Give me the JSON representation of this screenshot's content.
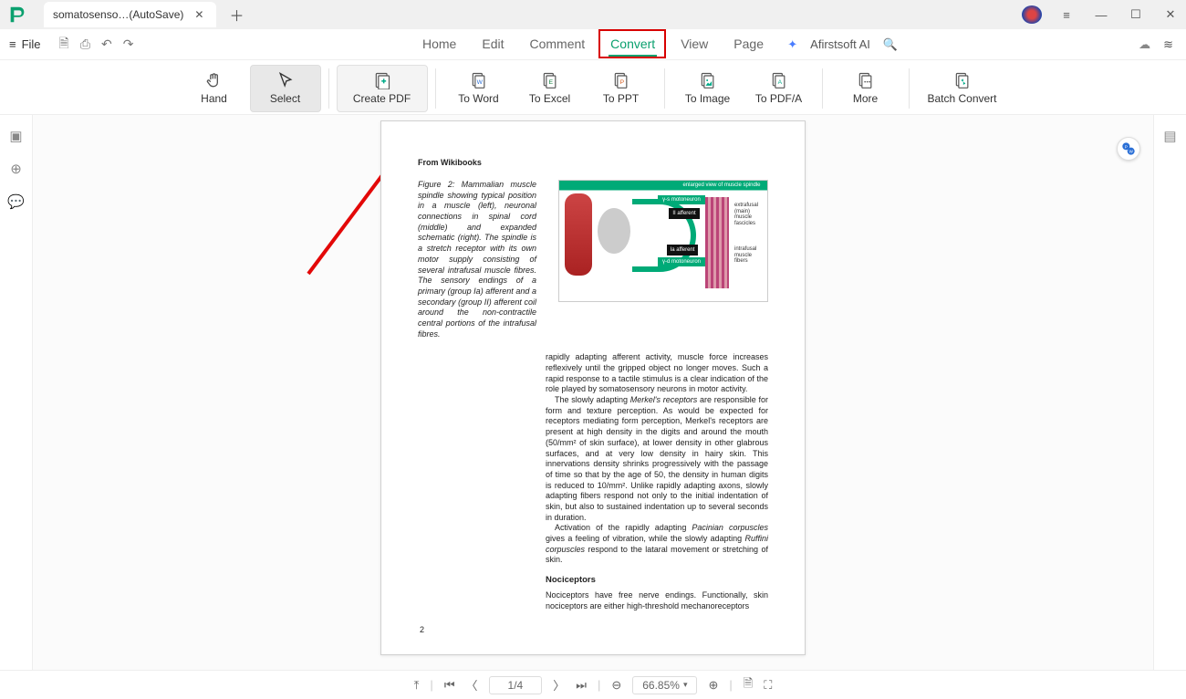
{
  "titlebar": {
    "tab_label": "somatosenso…(AutoSave)"
  },
  "menubar": {
    "file": "File",
    "items": [
      "Home",
      "Edit",
      "Comment",
      "Convert",
      "View",
      "Page"
    ],
    "active_index": 3,
    "ai_label": "Afirstsoft AI"
  },
  "ribbon": {
    "items": [
      {
        "label": "Hand"
      },
      {
        "label": "Select"
      },
      {
        "label": "Create PDF"
      },
      {
        "label": "To Word"
      },
      {
        "label": "To Excel"
      },
      {
        "label": "To PPT"
      },
      {
        "label": "To Image"
      },
      {
        "label": "To PDF/A"
      },
      {
        "label": "More"
      },
      {
        "label": "Batch Convert"
      }
    ]
  },
  "document": {
    "source_line": "From Wikibooks",
    "fig_caption": "Figure 2: Mammalian muscle spindle showing typical position in a muscle (left), neuronal connections in spinal cord (middle) and expanded schematic (right). The spindle is a stretch receptor with its own motor supply consisting of several intrafusal muscle fibres. The sensory endings of a primary (group Ia) afferent and a secondary (group II) afferent coil around the non-contractile central portions of the intrafusal fibres.",
    "para1": "rapidly adapting afferent activity, muscle force increases reflexively until the gripped object no longer moves. Such a rapid response to a tactile stimulus is a clear indication of the role played by somatosensory neurons in motor activity.",
    "para2_a": "The slowly adapting ",
    "para2_b": "Merkel's receptors",
    "para2_c": " are responsible for form and texture perception. As would be expected for receptors mediating form perception, Merkel's receptors are present at high density in the digits and around the mouth (50/mm² of skin surface), at lower density in other glabrous surfaces, and at very low density in hairy skin. This innervations density shrinks progressively with the passage of time so that by the age of 50, the density in human digits is reduced to 10/mm². Unlike rapidly adapting axons, slowly adapting fibers respond not only to the initial indentation of skin, but also to sustained indentation up to several seconds in duration.",
    "para3_a": "Activation of the rapidly adapting ",
    "para3_b": "Pacinian corpuscles",
    "para3_c": " gives a feeling of vibration, while the slowly adapting ",
    "para3_d": "Ruffini corpuscles",
    "para3_e": " respond to the lataral movement or stretching of skin.",
    "h_noci": "Nociceptors",
    "para4": "Nociceptors have free nerve endings. Functionally, skin nociceptors are either high-threshold mechanoreceptors",
    "page_num": "2"
  },
  "statusbar": {
    "page_indicator": "1/4",
    "zoom": "66.85%"
  }
}
